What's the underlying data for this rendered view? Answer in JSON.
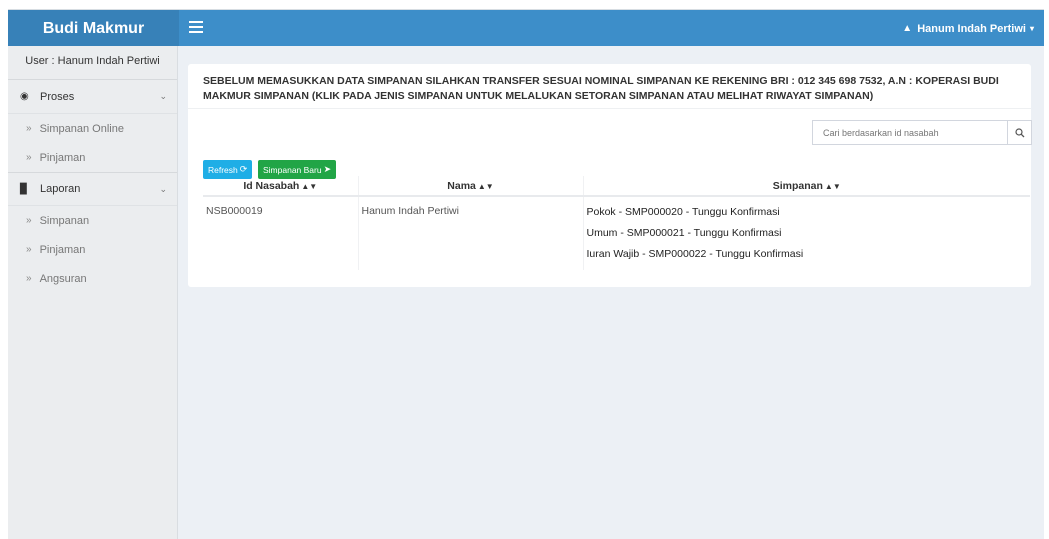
{
  "app": {
    "brand": "Budi Makmur"
  },
  "topbar": {
    "user_name": "Hanum Indah Pertiwi"
  },
  "sidebar": {
    "user_line": "User : Hanum Indah Pertiwi",
    "groups": [
      {
        "label": "Proses",
        "icon": "globe-icon",
        "items": [
          {
            "label": "Simpanan Online"
          },
          {
            "label": "Pinjaman"
          }
        ]
      },
      {
        "label": "Laporan",
        "icon": "book-icon",
        "items": [
          {
            "label": "Simpanan"
          },
          {
            "label": "Pinjaman"
          },
          {
            "label": "Angsuran"
          }
        ]
      }
    ]
  },
  "main": {
    "notice": "SEBELUM MEMASUKKAN DATA SIMPANAN SILAHKAN TRANSFER SESUAI NOMINAL SIMPANAN KE REKENING BRI : 012 345 698 7532, A.N : KOPERASI BUDI MAKMUR SIMPANAN (KLIK PADA JENIS SIMPANAN UNTUK MELALUKAN SETORAN SIMPANAN ATAU MELIHAT RIWAYAT SIMPANAN)",
    "search_placeholder": "Cari berdasarkan id nasabah",
    "refresh_label": "Refresh",
    "new_label": "Simpanan Baru",
    "table": {
      "headers": [
        "Id Nasabah",
        "Nama",
        "Simpanan"
      ],
      "rows": [
        {
          "id": "NSB000019",
          "nama": "Hanum Indah Pertiwi",
          "simpanan": [
            "Pokok - SMP000020 - Tunggu Konfirmasi",
            "Umum - SMP000021 - Tunggu Konfirmasi",
            "Iuran Wajib - SMP000022 - Tunggu Konfirmasi"
          ]
        }
      ]
    }
  },
  "colors": {
    "topbar": "#3d8ec9",
    "brand_bg": "#3781b8",
    "sidebar_bg": "#ebedef",
    "content_bg": "#ecf0f5",
    "refresh_btn": "#1faee6",
    "new_btn": "#21a546"
  }
}
